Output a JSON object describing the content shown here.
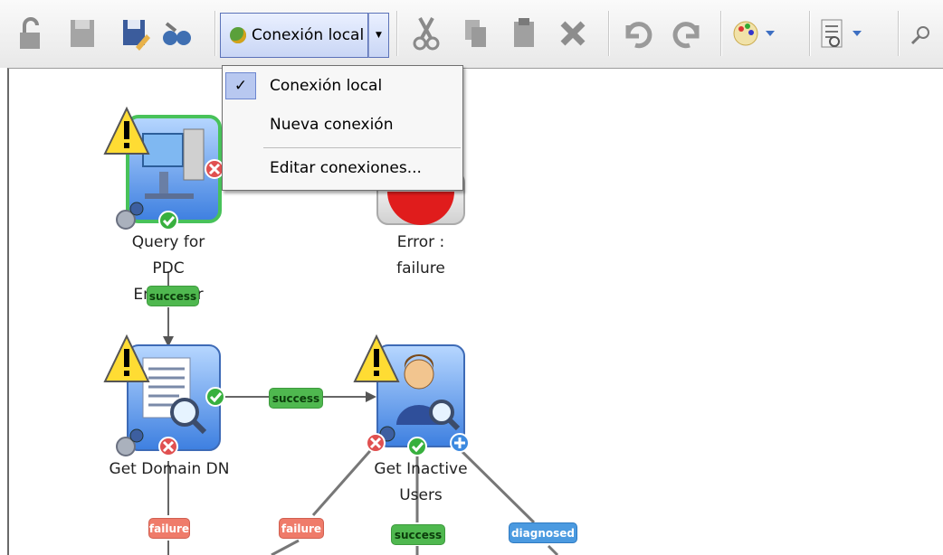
{
  "toolbar": {
    "connection_label": "Conexión local"
  },
  "connection_menu": {
    "items": [
      {
        "label": "Conexión local",
        "checked": true
      },
      {
        "label": "Nueva conexión",
        "checked": false
      },
      {
        "label": "Editar conexiones...",
        "checked": false
      }
    ]
  },
  "workflow": {
    "nodes": {
      "query_pdc": {
        "line1": "Query for PDC",
        "line2": "Emulator"
      },
      "error": {
        "line1": "Error :",
        "line2": "failure"
      },
      "get_domain_dn": {
        "line1": "Get Domain DN"
      },
      "get_inactive_users": {
        "line1": "Get Inactive",
        "line2": "Users"
      }
    },
    "badges": {
      "success": "success",
      "failure": "failure",
      "diagnosed": "diagnosed"
    }
  }
}
